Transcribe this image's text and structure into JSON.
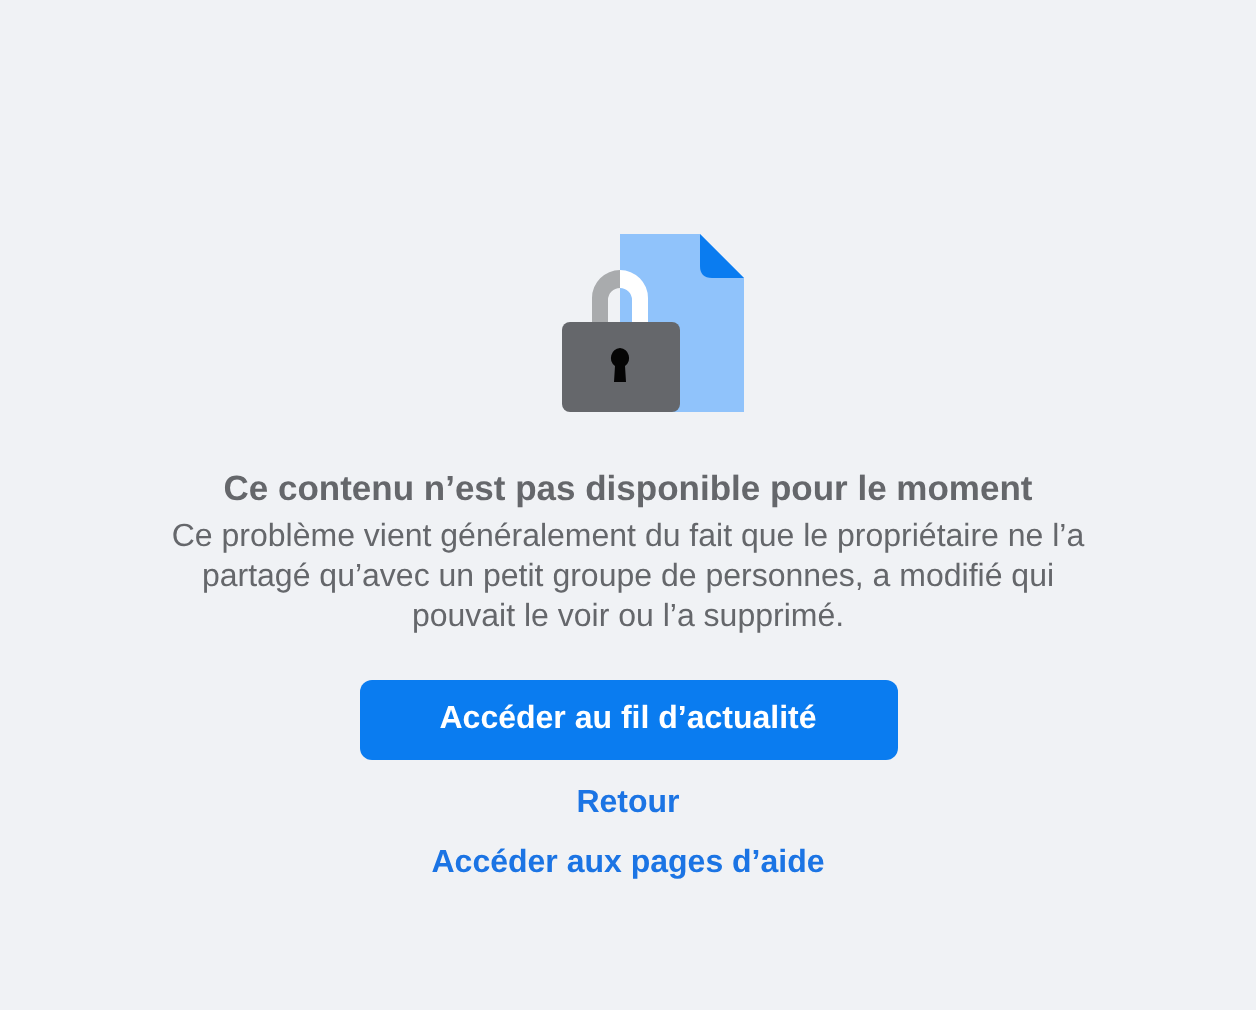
{
  "title": "Ce contenu n’est pas disponible pour le moment",
  "message": "Ce problème vient généralement du fait que le propriétaire ne l’a partagé qu’avec un petit groupe de personnes, a modifié qui pouvait le voir ou l’a supprimé.",
  "primary_button": "Accéder au fil d’actualité",
  "links": [
    "Retour",
    "Accéder aux pages d’aide"
  ]
}
